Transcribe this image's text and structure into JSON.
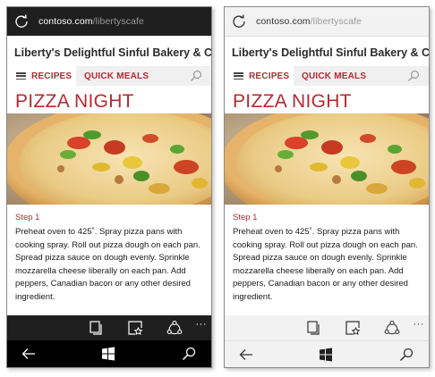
{
  "screens": [
    {
      "theme": "dark",
      "address_bar": {
        "domain": "contoso.com",
        "path": "/libertyscafe"
      },
      "site_title": "Liberty's Delightful Sinful Bakery & Café",
      "nav": {
        "tabs": [
          "RECIPES",
          "QUICK MEALS"
        ]
      },
      "page_heading": "PIZZA NIGHT",
      "step_title": "Step 1",
      "step_body": "Preheat oven to 425˚. Spray pizza pans with cooking spray. Roll out pizza dough on each pan. Spread pizza sauce on dough evenly. Sprinkle mozzarella cheese liberally on each pan. Add peppers, Canadian bacon or any other desired ingredient.",
      "app_bar": {
        "more_label": "···"
      }
    },
    {
      "theme": "light",
      "address_bar": {
        "domain": "contoso.com",
        "path": "/libertyscafe"
      },
      "site_title": "Liberty's Delightful Sinful Bakery & Café",
      "nav": {
        "tabs": [
          "RECIPES",
          "QUICK MEALS"
        ]
      },
      "page_heading": "PIZZA NIGHT",
      "step_title": "Step 1",
      "step_body": "Preheat oven to 425˚. Spray pizza pans with cooking spray. Roll out pizza dough on each pan. Spread pizza sauce on dough evenly. Sprinkle mozzarella cheese liberally on each pan. Add peppers, Canadian bacon or any other desired ingredient.",
      "app_bar": {
        "more_label": "···"
      }
    }
  ],
  "icons": [
    "refresh-icon",
    "hamburger-icon",
    "search-icon",
    "tabs-icon",
    "reading-list-icon",
    "share-icon",
    "back-arrow-icon",
    "windows-logo-icon",
    "search-icon"
  ],
  "colors": {
    "accent": "#b52a32",
    "dark_chrome": "#1f1f1f",
    "light_chrome": "#f2f2f2"
  }
}
